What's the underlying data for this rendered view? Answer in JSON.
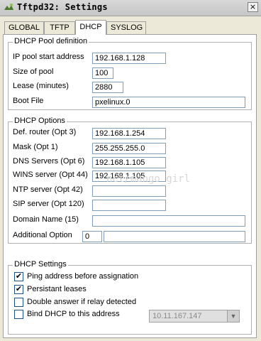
{
  "window": {
    "title": "Tftpd32: Settings",
    "close_glyph": "×"
  },
  "tabs": [
    {
      "label": "GLOBAL"
    },
    {
      "label": "TFTP"
    },
    {
      "label": "DHCP",
      "active": true
    },
    {
      "label": "SYSLOG"
    }
  ],
  "pool": {
    "title": "DHCP Pool definition",
    "start_label": "IP pool start address",
    "start_value": "192.168.1.128",
    "size_label": "Size of pool",
    "size_value": "100",
    "lease_label": "Lease (minutes)",
    "lease_value": "2880",
    "boot_label": "Boot File",
    "boot_value": "pxelinux.0"
  },
  "options": {
    "title": "DHCP Options",
    "router_label": "Def. router (Opt 3)",
    "router_value": "192.168.1.254",
    "mask_label": "Mask (Opt 1)",
    "mask_value": "255.255.255.0",
    "dns_label": "DNS Servers (Opt 6)",
    "dns_value": "192.168.1.105",
    "wins_label": "WINS server (Opt 44)",
    "wins_value": "192.168.1.105",
    "ntp_label": "NTP server (Opt 42)",
    "ntp_value": "",
    "sip_label": "SIP server (Opt 120)",
    "sip_value": "",
    "domain_label": "Domain Name (15)",
    "domain_value": "",
    "additional_label": "Additional Option",
    "additional_num": "0",
    "additional_value": ""
  },
  "settings": {
    "title": "DHCP Settings",
    "ping_label": "Ping address before assignation",
    "ping_checked": true,
    "ping_mark": "✔",
    "persist_label": "Persistant leases",
    "persist_checked": true,
    "persist_mark": "✔",
    "double_label": "Double answer if relay detected",
    "double_checked": false,
    "bind_label": "Bind DHCP to this address",
    "bind_checked": false,
    "bind_address": "10.11.167.147"
  },
  "watermark": "net/mango_girl"
}
